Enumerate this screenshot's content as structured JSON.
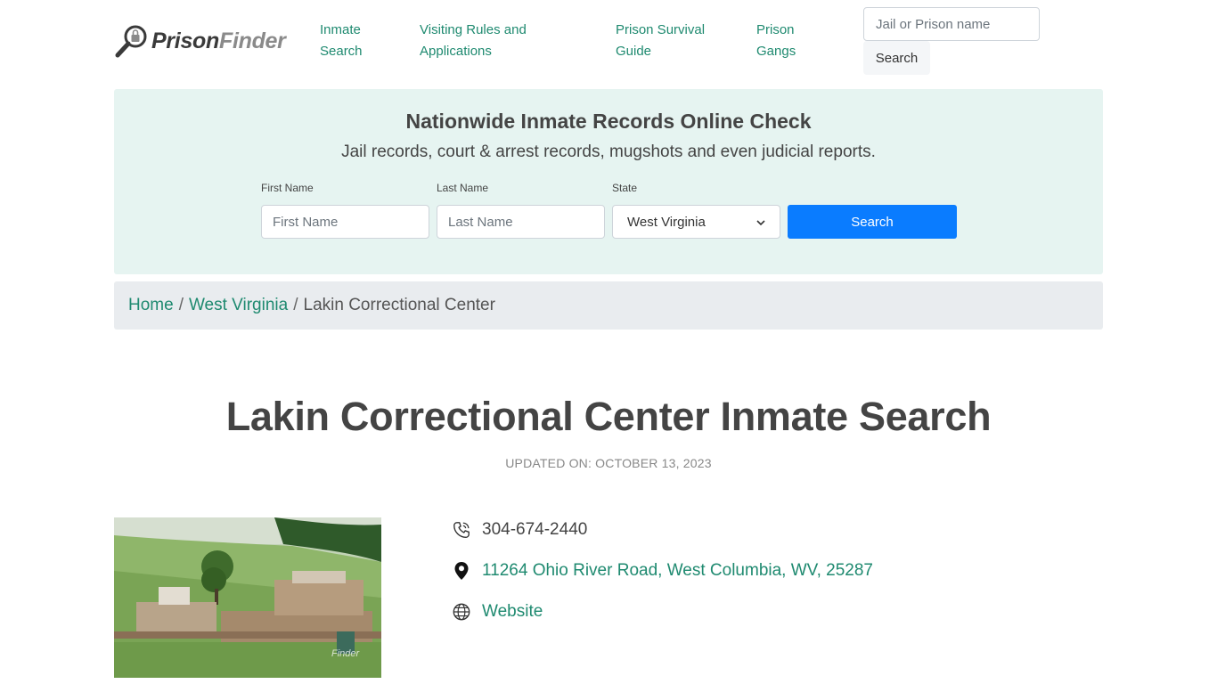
{
  "header": {
    "logo_part1": "Prison",
    "logo_part2": "Finder",
    "nav": [
      {
        "label_line1": "Inmate",
        "label_line2": "Search"
      },
      {
        "label_line1": "Visiting Rules and",
        "label_line2": "Applications"
      },
      {
        "label_line1": "Prison Survival",
        "label_line2": "Guide"
      },
      {
        "label_line1": "Prison",
        "label_line2": "Gangs"
      }
    ],
    "search_placeholder": "Jail or Prison name",
    "search_button": "Search"
  },
  "hero": {
    "title": "Nationwide Inmate Records Online Check",
    "subtitle": "Jail records, court & arrest records, mugshots and even judicial reports.",
    "first_name_label": "First Name",
    "first_name_placeholder": "First Name",
    "last_name_label": "Last Name",
    "last_name_placeholder": "Last Name",
    "state_label": "State",
    "state_value": "West Virginia",
    "search_button": "Search"
  },
  "breadcrumb": {
    "home": "Home",
    "state": "West Virginia",
    "current": "Lakin Correctional Center",
    "separator": "/"
  },
  "main": {
    "title": "Lakin Correctional Center Inmate Search",
    "updated": "UPDATED ON: OCTOBER 13, 2023",
    "photo_watermark": "Finder",
    "phone": "304-674-2440",
    "address": "11264 Ohio River Road, West Columbia, WV, 25287",
    "website": "Website"
  },
  "colors": {
    "accent_green": "#1f8a70",
    "hero_bg": "#e6f4f1",
    "primary_button": "#0a7cff"
  }
}
